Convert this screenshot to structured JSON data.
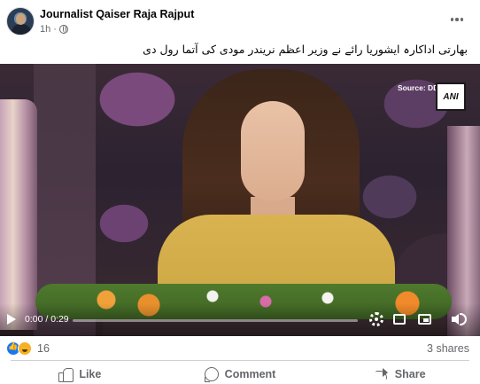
{
  "post": {
    "author": "Journalist Qaiser Raja Rajput",
    "time": "1h",
    "dot": "·",
    "audience_icon": "globe-icon",
    "caption": "بھارتی اداکارہ ایشوریا رائے نے وزیر اعظم نریندر مودی کی آتما رول دی"
  },
  "video": {
    "source_label": "Source: DD",
    "logo_text": "ANI",
    "time": "0:00 / 0:29",
    "progress": 0.0,
    "controls": [
      "play-icon",
      "gear-icon",
      "expand-icon",
      "pip-icon",
      "volume-icon"
    ]
  },
  "engagement": {
    "reaction_icons": [
      "like-reaction-icon",
      "haha-reaction-icon"
    ],
    "reaction_count": "16",
    "shares": "3 shares"
  },
  "actions": {
    "like": "Like",
    "comment": "Comment",
    "share": "Share"
  },
  "colors": {
    "brand_blue": "#1877f2",
    "secondary_text": "#65676b",
    "divider": "#ced0d4"
  }
}
